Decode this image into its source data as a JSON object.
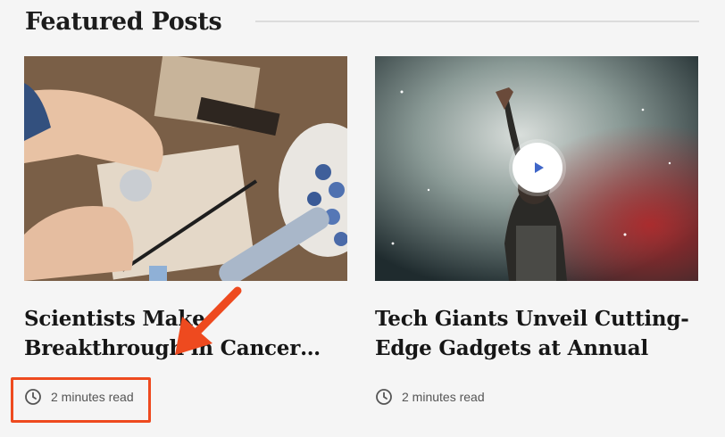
{
  "section": {
    "title": "Featured Posts"
  },
  "posts": [
    {
      "title": "Scientists Make Breakthrough in Cancer…",
      "read_time": "2 minutes read",
      "has_video": false
    },
    {
      "title": "Tech Giants Unveil Cutting-Edge Gadgets at Annual Expo",
      "read_time": "2 minutes read",
      "has_video": true
    }
  ],
  "icons": {
    "read_time": "clock-icon",
    "play": "play-icon",
    "annotation": "arrow-icon"
  },
  "colors": {
    "annotation": "#ee4a1f",
    "play_icon": "#3f66c8"
  }
}
